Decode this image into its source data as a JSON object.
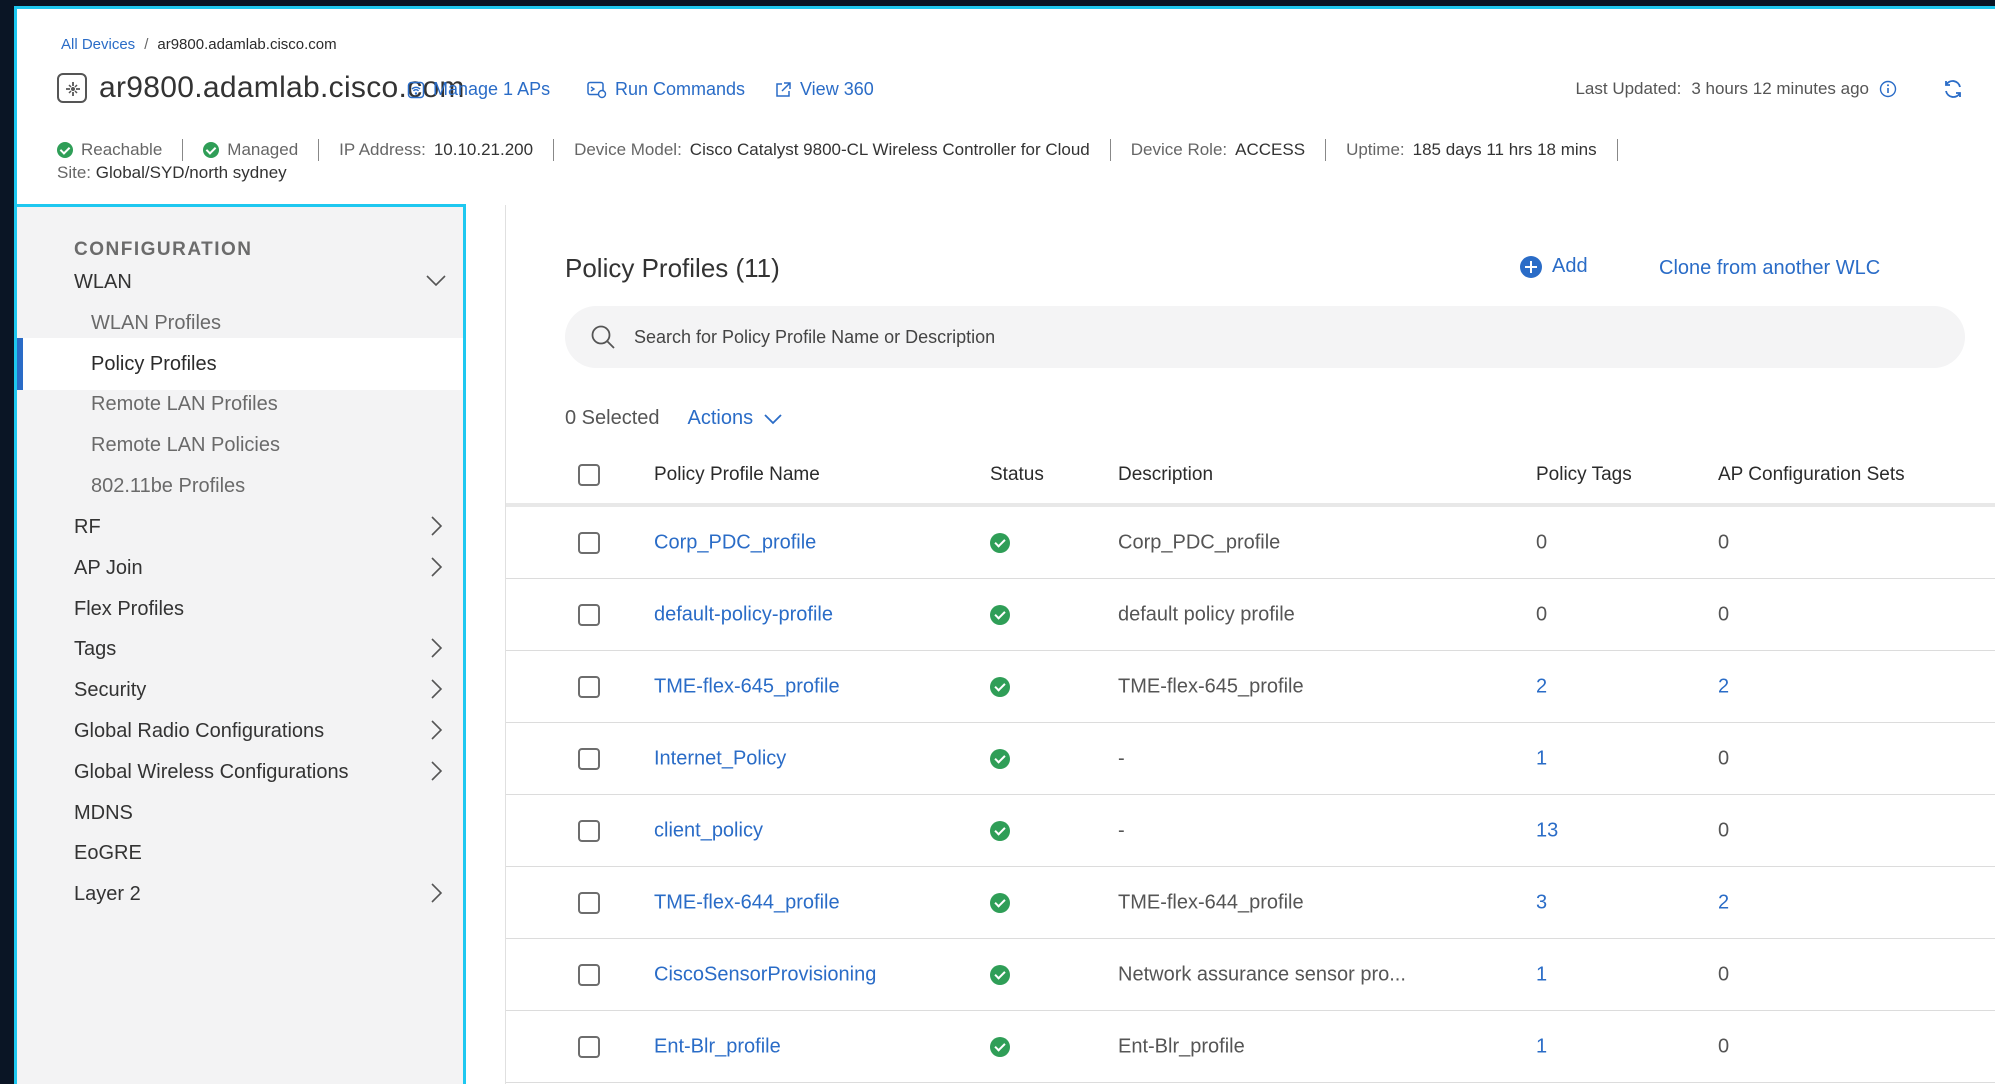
{
  "breadcrumb": {
    "root": "All Devices",
    "separator": "/",
    "current": "ar9800.adamlab.cisco.com"
  },
  "device": {
    "name": "ar9800.adamlab.cisco.com",
    "manage_aps": "Manage 1 APs",
    "run_commands": "Run Commands",
    "view_360": "View 360",
    "last_updated_label": "Last Updated:",
    "last_updated_value": "3 hours 12 minutes ago"
  },
  "status": {
    "reachable": "Reachable",
    "managed": "Managed",
    "ip_label": "IP Address:",
    "ip_value": "10.10.21.200",
    "model_label": "Device Model:",
    "model_value": "Cisco Catalyst 9800-CL Wireless Controller for Cloud",
    "role_label": "Device Role:",
    "role_value": "ACCESS",
    "uptime_label": "Uptime:",
    "uptime_value": "185 days 11 hrs 18 mins",
    "site_label": "Site:",
    "site_value": "Global/SYD/north sydney"
  },
  "sidebar": {
    "heading": "CONFIGURATION",
    "items": [
      {
        "label": "WLAN",
        "level": "top",
        "chevron": "down"
      },
      {
        "label": "WLAN Profiles",
        "level": "sub"
      },
      {
        "label": "Policy Profiles",
        "level": "sub",
        "active": true
      },
      {
        "label": "Remote LAN Profiles",
        "level": "sub"
      },
      {
        "label": "Remote LAN Policies",
        "level": "sub"
      },
      {
        "label": "802.11be Profiles",
        "level": "sub"
      },
      {
        "label": "RF",
        "level": "top",
        "chevron": "right"
      },
      {
        "label": "AP Join",
        "level": "top",
        "chevron": "right"
      },
      {
        "label": "Flex Profiles",
        "level": "top"
      },
      {
        "label": "Tags",
        "level": "top",
        "chevron": "right"
      },
      {
        "label": "Security",
        "level": "top",
        "chevron": "right"
      },
      {
        "label": "Global Radio Configurations",
        "level": "top",
        "chevron": "right"
      },
      {
        "label": "Global Wireless Configurations",
        "level": "top",
        "chevron": "right"
      },
      {
        "label": "MDNS",
        "level": "top"
      },
      {
        "label": "EoGRE",
        "level": "top"
      },
      {
        "label": "Layer 2",
        "level": "top",
        "chevron": "right"
      }
    ]
  },
  "main": {
    "title": "Policy Profiles (11)",
    "add_label": "Add",
    "clone_label": "Clone from another WLC",
    "search_placeholder": "Search for Policy Profile Name or Description",
    "selected_text": "0 Selected",
    "actions_label": "Actions",
    "columns": [
      "Policy Profile Name",
      "Status",
      "Description",
      "Policy Tags",
      "AP Configuration Sets"
    ],
    "rows": [
      {
        "name": "Corp_PDC_profile",
        "status": "ok",
        "description": "Corp_PDC_profile",
        "policy_tags": "0",
        "ap_sets": "0",
        "tags_link": false,
        "ap_link": false
      },
      {
        "name": "default-policy-profile",
        "status": "ok",
        "description": "default policy profile",
        "policy_tags": "0",
        "ap_sets": "0",
        "tags_link": false,
        "ap_link": false
      },
      {
        "name": "TME-flex-645_profile",
        "status": "ok",
        "description": "TME-flex-645_profile",
        "policy_tags": "2",
        "ap_sets": "2",
        "tags_link": true,
        "ap_link": true
      },
      {
        "name": "Internet_Policy",
        "status": "ok",
        "description": "-",
        "policy_tags": "1",
        "ap_sets": "0",
        "tags_link": true,
        "ap_link": false
      },
      {
        "name": "client_policy",
        "status": "ok",
        "description": "-",
        "policy_tags": "13",
        "ap_sets": "0",
        "tags_link": true,
        "ap_link": false
      },
      {
        "name": "TME-flex-644_profile",
        "status": "ok",
        "description": "TME-flex-644_profile",
        "policy_tags": "3",
        "ap_sets": "2",
        "tags_link": true,
        "ap_link": true
      },
      {
        "name": "CiscoSensorProvisioning",
        "status": "ok",
        "description": "Network assurance sensor pro...",
        "policy_tags": "1",
        "ap_sets": "0",
        "tags_link": true,
        "ap_link": false
      },
      {
        "name": "Ent-Blr_profile",
        "status": "ok",
        "description": "Ent-Blr_profile",
        "policy_tags": "1",
        "ap_sets": "0",
        "tags_link": true,
        "ap_link": false
      }
    ]
  },
  "colors": {
    "accent": "#2a6cc7",
    "ok": "#2f9e57",
    "highlight_border": "#1ec8f0"
  }
}
